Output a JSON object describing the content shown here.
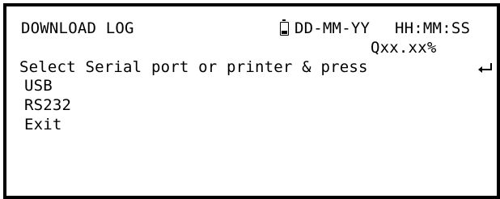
{
  "header": {
    "title": "DOWNLOAD LOG",
    "battery_icon": "battery-icon",
    "battery_level": 0.25,
    "date": "DD-MM-YY",
    "time": "HH:MM:SS",
    "quality": "Qxx.xx%"
  },
  "prompt": {
    "text": "Select Serial port or printer & press",
    "enter_icon": "enter-key-icon"
  },
  "menu": {
    "items": [
      {
        "label": "USB"
      },
      {
        "label": "RS232"
      },
      {
        "label": "Exit"
      }
    ]
  },
  "colors": {
    "background": "#ffffff",
    "foreground": "#000000"
  }
}
